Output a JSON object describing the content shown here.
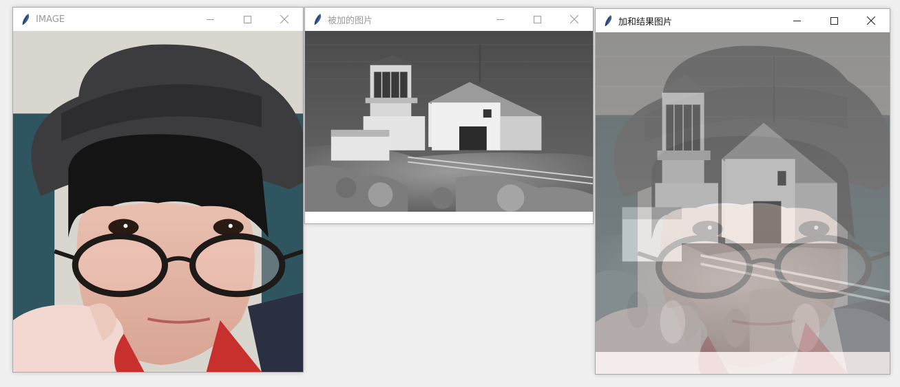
{
  "windows": [
    {
      "title": "IMAGE",
      "active": false
    },
    {
      "title": "被加的图片",
      "active": false
    },
    {
      "title": "加和结果图片",
      "active": true
    }
  ],
  "colors": {
    "desktop": "#f0f0f0",
    "title_inactive": "#999999",
    "title_active": "#1a1a1a",
    "feather_icon": "#3b5f96"
  },
  "icons": [
    "feather-icon",
    "minimize-icon",
    "maximize-icon",
    "close-icon"
  ]
}
